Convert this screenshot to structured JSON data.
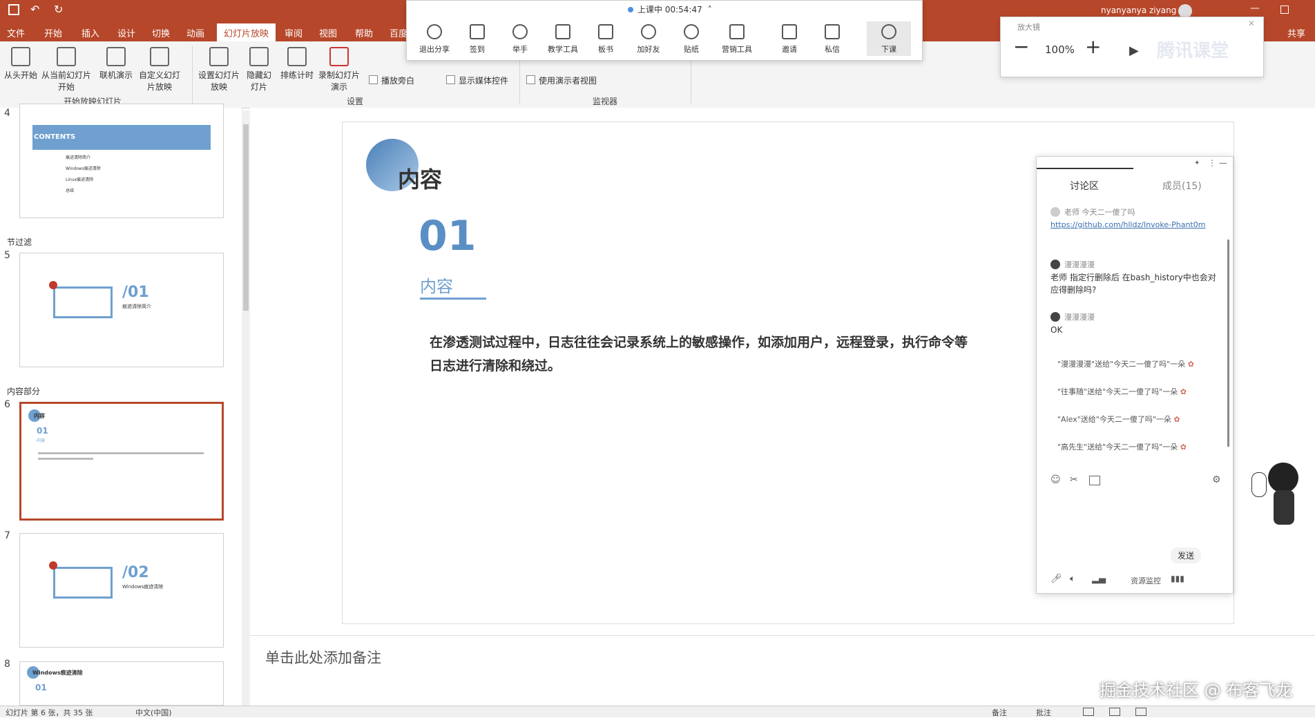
{
  "titlebar": {
    "user": "nyanyanya ziyang"
  },
  "ribbon_tabs": [
    "文件",
    "开始",
    "插入",
    "设计",
    "切换",
    "动画",
    "幻灯片放映",
    "审阅",
    "视图",
    "帮助",
    "百度"
  ],
  "ribbon_groups": {
    "start": {
      "label": "开始放映幻灯片",
      "buttons": [
        "从头开始",
        "从当前幻灯片开始",
        "联机演示",
        "自定义幻灯片放映"
      ]
    },
    "setup": {
      "label": "设置",
      "buttons": [
        "设置幻灯片放映",
        "隐藏幻灯片",
        "排练计时",
        "录制幻灯片演示"
      ],
      "checks": [
        "播放旁白",
        "显示媒体控件"
      ]
    },
    "monitor": {
      "label": "监视器",
      "checks": [
        "使用演示者视图"
      ]
    }
  },
  "class_toolbar": {
    "status": "上课中 00:54:47",
    "buttons": [
      "退出分享",
      "签到",
      "举手",
      "教学工具",
      "板书",
      "加好友",
      "贴纸",
      "营销工具",
      "邀请",
      "私信",
      "下课"
    ]
  },
  "zoom_widget": {
    "title": "放大镜",
    "zoom": "100%",
    "brand": "腾讯课堂"
  },
  "share_label": "共享",
  "thumbnails": {
    "items": [
      {
        "num": "4",
        "title": "CONTENTS",
        "lines": [
          "痕迹清除简介",
          "Windows痕迹清除",
          "Linux痕迹清除",
          "总结"
        ]
      },
      {
        "num": "5",
        "big": "/01",
        "sub": "痕迹清除简介"
      },
      {
        "num": "6",
        "title": "内容",
        "big": "01",
        "sub": "内容"
      },
      {
        "num": "7",
        "big": "/02",
        "sub": "Windows痕迹清除"
      },
      {
        "num": "8",
        "title": "Windows痕迹清除",
        "big": "01"
      }
    ],
    "sections": [
      "节过滤",
      "内容部分"
    ]
  },
  "slide": {
    "title": "内容",
    "number": "01",
    "subtitle": "内容",
    "body_line1": "在渗透测试过程中，日志往往会记录系统上的敏感操作，如添加用户，远程登录，执行命令等",
    "body_line2": "日志进行清除和绕过。"
  },
  "notes": {
    "placeholder": "单击此处添加备注"
  },
  "chat": {
    "tab_discussion": "讨论区",
    "tab_members": "成员(15)",
    "messages": [
      {
        "sender": "老师 今天二一傻了吗",
        "text": "https://github.com/hlldz/Invoke-Phant0m"
      },
      {
        "sender": "漫漫漫漫",
        "text": "老师 指定行删除后 在bash_history中也会对应得删除吗?"
      },
      {
        "sender": "漫漫漫漫",
        "text": "OK"
      }
    ],
    "gifts": [
      "\"漫漫漫漫\"送给\"今天二一傻了吗\"一朵",
      "\"往事随\"送给\"今天二一傻了吗\"一朵",
      "\"Alex\"送给\"今天二一傻了吗\"一朵",
      "\"高先生\"送给\"今天二一傻了吗\"一朵"
    ],
    "send": "发送",
    "resource": "资源监控"
  },
  "statusbar": {
    "left": "幻灯片 第 6 张，共 35 张",
    "lang": "中文(中国)",
    "notes": "备注",
    "comments": "批注"
  },
  "watermark": "掘金技术社区 @ 布客飞龙",
  "colors": {
    "accent": "#b7472a",
    "slide_blue": "#6fa0cf"
  }
}
